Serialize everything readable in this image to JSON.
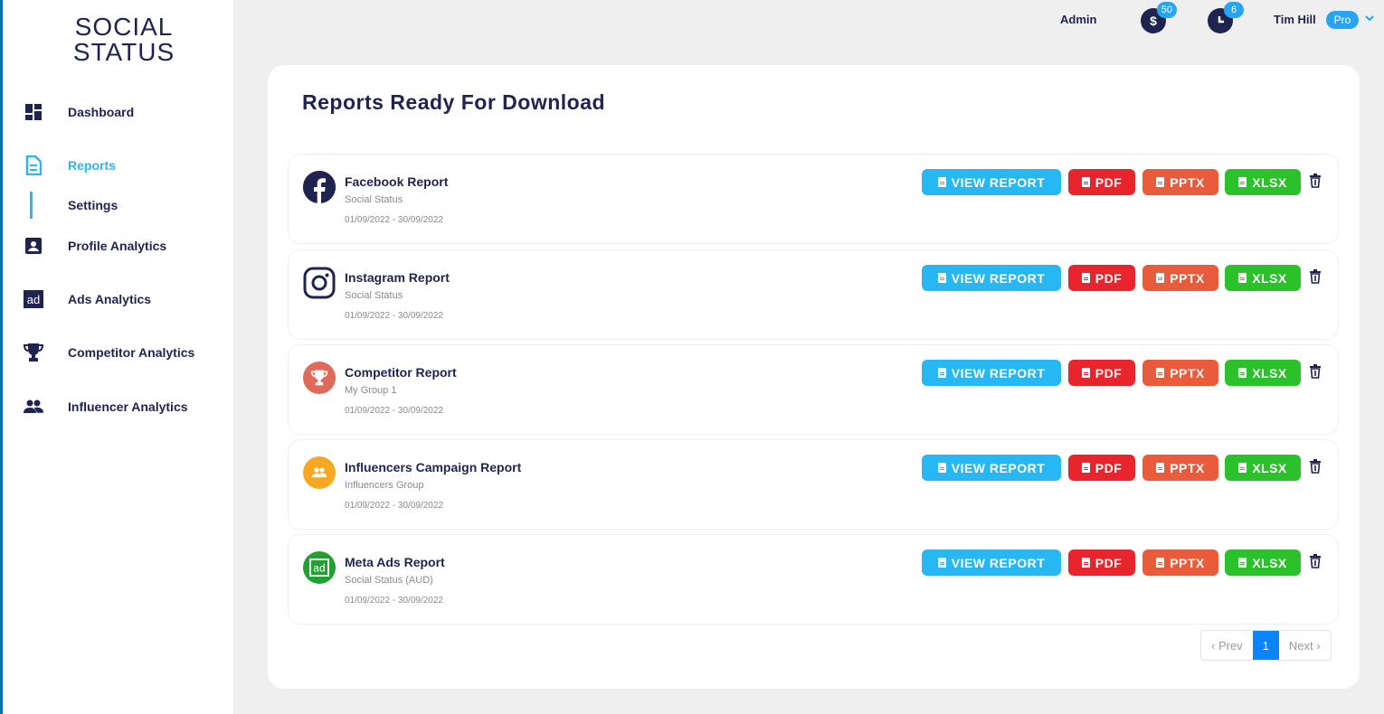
{
  "brand": {
    "line1": "SOCIAL",
    "line2": "STATUS"
  },
  "sidebar": {
    "items": [
      {
        "label": "Dashboard",
        "icon": "dashboard-icon"
      },
      {
        "label": "Reports",
        "icon": "reports-icon",
        "active": true
      },
      {
        "label": "Settings",
        "icon": ""
      },
      {
        "label": "Profile Analytics",
        "icon": "profile-icon"
      },
      {
        "label": "Ads Analytics",
        "icon": "ads-icon"
      },
      {
        "label": "Competitor Analytics",
        "icon": "trophy-icon"
      },
      {
        "label": "Influencer Analytics",
        "icon": "people-icon"
      }
    ]
  },
  "topbar": {
    "admin_label": "Admin",
    "notif_count": "50",
    "tasks_count": "6",
    "user_name": "Tim Hill",
    "plan_badge": "Pro"
  },
  "main": {
    "title": "Reports Ready For Download",
    "buttons": {
      "view": "VIEW REPORT",
      "pdf": "PDF",
      "pptx": "PPTX",
      "xlsx": "XLSX"
    },
    "reports": [
      {
        "name": "Facebook Report",
        "subtitle": "Social Status",
        "date_range": "01/09/2022 - 30/09/2022",
        "icon": "facebook-icon"
      },
      {
        "name": "Instagram Report",
        "subtitle": "Social Status",
        "date_range": "01/09/2022 - 30/09/2022",
        "icon": "instagram-icon"
      },
      {
        "name": "Competitor Report",
        "subtitle": "My Group 1",
        "date_range": "01/09/2022 - 30/09/2022",
        "icon": "trophy-icon"
      },
      {
        "name": "Influencers Campaign Report",
        "subtitle": "Influencers Group",
        "date_range": "01/09/2022 - 30/09/2022",
        "icon": "people-icon"
      },
      {
        "name": "Meta Ads Report",
        "subtitle": "Social Status (AUD)",
        "date_range": "01/09/2022 - 30/09/2022",
        "icon": "ads-icon"
      }
    ],
    "pagination": {
      "prev": "‹ Prev",
      "current": "1",
      "next": "Next ›"
    }
  },
  "colors": {
    "navy": "#1f2350",
    "accent_blue": "#27b7f2",
    "pdf_red": "#e8252c",
    "pptx_orange": "#ea5b3c",
    "xlsx_green": "#2bc12b",
    "facebook": "#1f2350",
    "competitor": "#e06a5a",
    "influencer": "#f7a823",
    "meta_ads": "#22a034"
  }
}
